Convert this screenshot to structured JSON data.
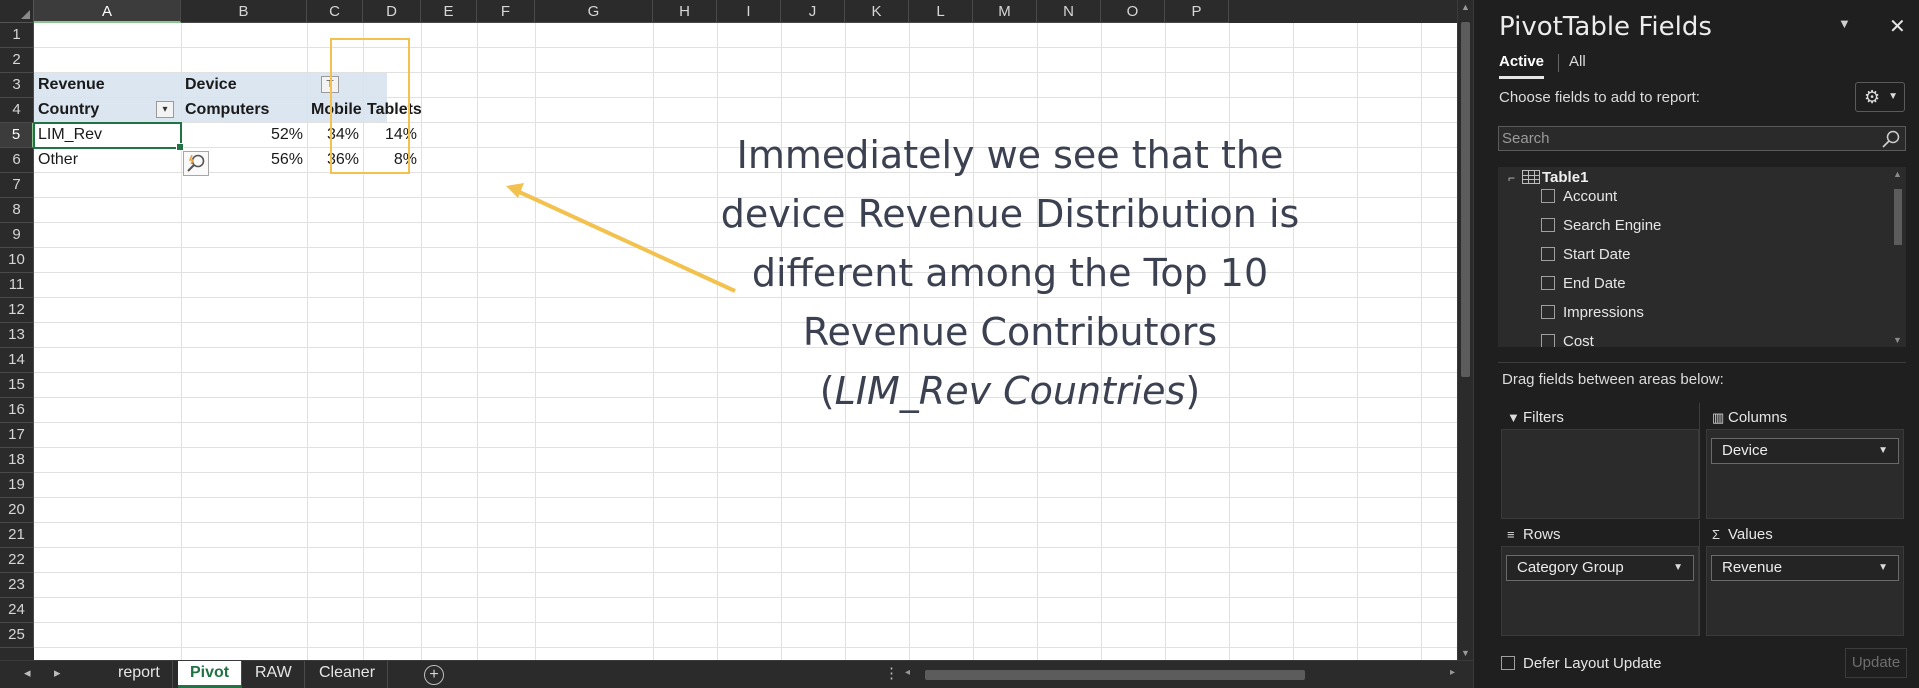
{
  "sheet": {
    "columns": [
      "A",
      "B",
      "C",
      "D",
      "E",
      "F",
      "G",
      "H",
      "I",
      "J",
      "K",
      "L",
      "M",
      "N",
      "O",
      "P"
    ],
    "selected_column": "A",
    "rows": [
      "1",
      "2",
      "3",
      "4",
      "5",
      "6",
      "7",
      "8",
      "9",
      "10",
      "11",
      "12",
      "13",
      "14",
      "15",
      "16",
      "17",
      "18",
      "19",
      "20",
      "21",
      "22",
      "23",
      "24",
      "25"
    ],
    "selected_row": "5",
    "pivot": {
      "row3": {
        "a": "Revenue",
        "b": "Device"
      },
      "row4": {
        "a": "Country",
        "b": "Computers",
        "c": "Mobile",
        "d": "Tablets"
      },
      "data_rows": [
        {
          "label": "LIM_Rev",
          "computers": "52%",
          "mobile": "34%",
          "tablets": "14%"
        },
        {
          "label": "Other",
          "computers": "56%",
          "mobile": "36%",
          "tablets": "8%"
        }
      ]
    },
    "annotation": {
      "line1": "Immediately we see that the",
      "line2": "device Revenue Distribution is",
      "line3": "different among the Top 10",
      "line4": "Revenue Contributors",
      "line5_open": "(",
      "line5_italic": "LIM_Rev Countries",
      "line5_close": ")"
    },
    "highlight_color": "#f2c14e"
  },
  "tabs": {
    "sheets": [
      {
        "label": "report",
        "active": false
      },
      {
        "label": "Pivot",
        "active": true
      },
      {
        "label": "RAW",
        "active": false
      },
      {
        "label": "Cleaner",
        "active": false
      }
    ],
    "add_symbol": "+",
    "more_symbol": "⋮"
  },
  "pane": {
    "title": "PivotTable Fields",
    "tab_active": "Active",
    "tab_all": "All",
    "choose_label": "Choose fields to add to report:",
    "search_placeholder": "Search",
    "table_name": "Table1",
    "fields": [
      "Account",
      "Search Engine",
      "Start Date",
      "End Date",
      "Impressions",
      "Cost"
    ],
    "drag_label": "Drag fields between areas below:",
    "areas": {
      "filters": {
        "title": "Filters",
        "items": []
      },
      "columns": {
        "title": "Columns",
        "items": [
          "Device"
        ]
      },
      "rows": {
        "title": "Rows",
        "items": [
          "Category Group"
        ]
      },
      "values": {
        "title": "Values",
        "items": [
          "Revenue"
        ]
      }
    },
    "defer_label": "Defer Layout Update",
    "update_label": "Update",
    "accent_color": "#217346"
  }
}
